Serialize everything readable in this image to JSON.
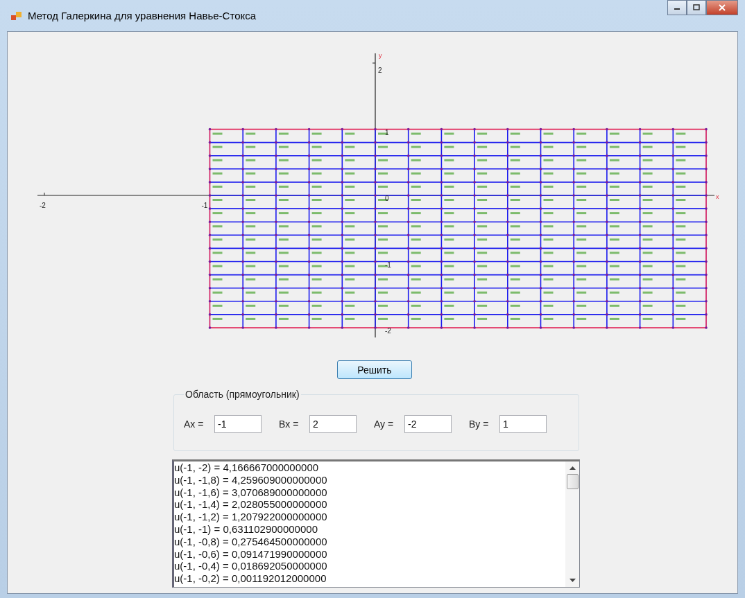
{
  "window": {
    "title": "Метод Галеркина для уравнения Навье-Стокса"
  },
  "plot": {
    "x_label": "x",
    "y_label": "y",
    "x_tick_labels": [
      "-2",
      "-1"
    ],
    "y_tick_labels": [
      "2",
      "1",
      "0",
      "-1",
      "-2"
    ]
  },
  "solve_button": {
    "label": "Решить"
  },
  "domain_group": {
    "title": "Область (прямоугольник)",
    "fields": [
      {
        "label": "Ax =",
        "value": "-1"
      },
      {
        "label": "Bx =",
        "value": "2"
      },
      {
        "label": "Ay =",
        "value": "-2"
      },
      {
        "label": "By =",
        "value": "1"
      }
    ]
  },
  "results": [
    "u(-1, -2) = 4,166667000000000",
    "u(-1, -1,8) = 4,259609000000000",
    "u(-1, -1,6) = 3,070689000000000",
    "u(-1, -1,4) = 2,028055000000000",
    "u(-1, -1,2) = 1,207922000000000",
    "u(-1, -1) = 0,631102900000000",
    "u(-1, -0,8) = 0,275464500000000",
    "u(-1, -0,6) = 0,091471990000000",
    "u(-1, -0,4) = 0,018692050000000",
    "u(-1, -0,2) = 0,001192012000000"
  ]
}
